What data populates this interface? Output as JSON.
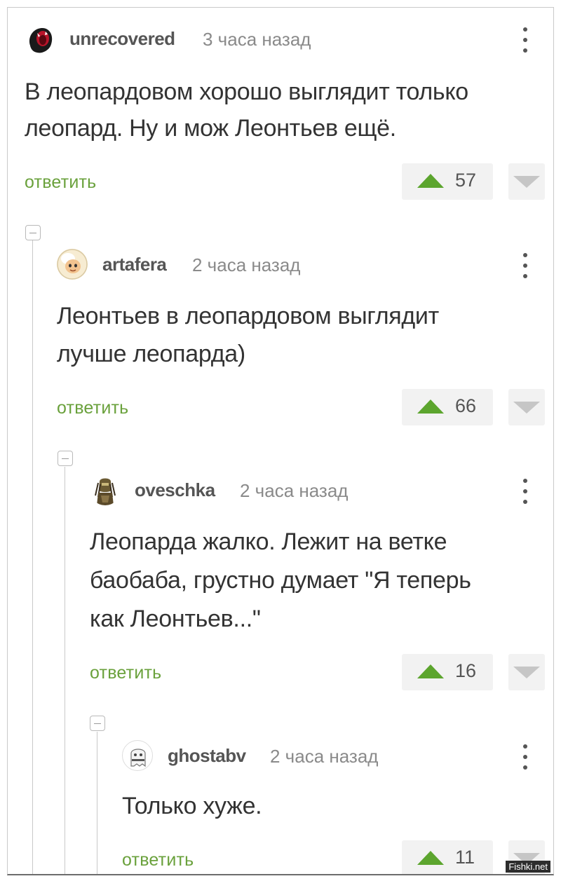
{
  "comments": [
    {
      "author": "unrecovered",
      "time": "3 часа назад",
      "lines": [
        "В леопардовом хорошо выглядит только",
        "леопард. Ну и мож Леонтьев ещё."
      ],
      "reply_label": "ответить",
      "score": "57",
      "avatar_icon": "screaming-face-icon"
    },
    {
      "author": "artafera",
      "time": "2 часа назад",
      "lines": [
        "Леонтьев в леопардовом выглядит",
        "лучше леопарда)"
      ],
      "reply_label": "ответить",
      "score": "66",
      "avatar_icon": "cartoon-face-icon"
    },
    {
      "author": "oveschka",
      "time": "2 часа назад",
      "lines": [
        "Леопарда жалко. Лежит на ветке",
        "баобаба, грустно думает \"Я теперь",
        "как Леонтьев...\""
      ],
      "reply_label": "ответить",
      "score": "16",
      "avatar_icon": "predator-icon"
    },
    {
      "author": "ghostabv",
      "time": "2 часа назад",
      "lines": [
        "Только хуже."
      ],
      "reply_label": "ответить",
      "score": "11",
      "avatar_icon": "ghost-icon"
    }
  ],
  "watermark": "Fishki.net",
  "colors": {
    "accent_green": "#5ca52e",
    "reply_green": "#6aa13c",
    "text": "#333333",
    "muted": "#8a8a8a",
    "vote_bg": "#f2f2f2"
  }
}
